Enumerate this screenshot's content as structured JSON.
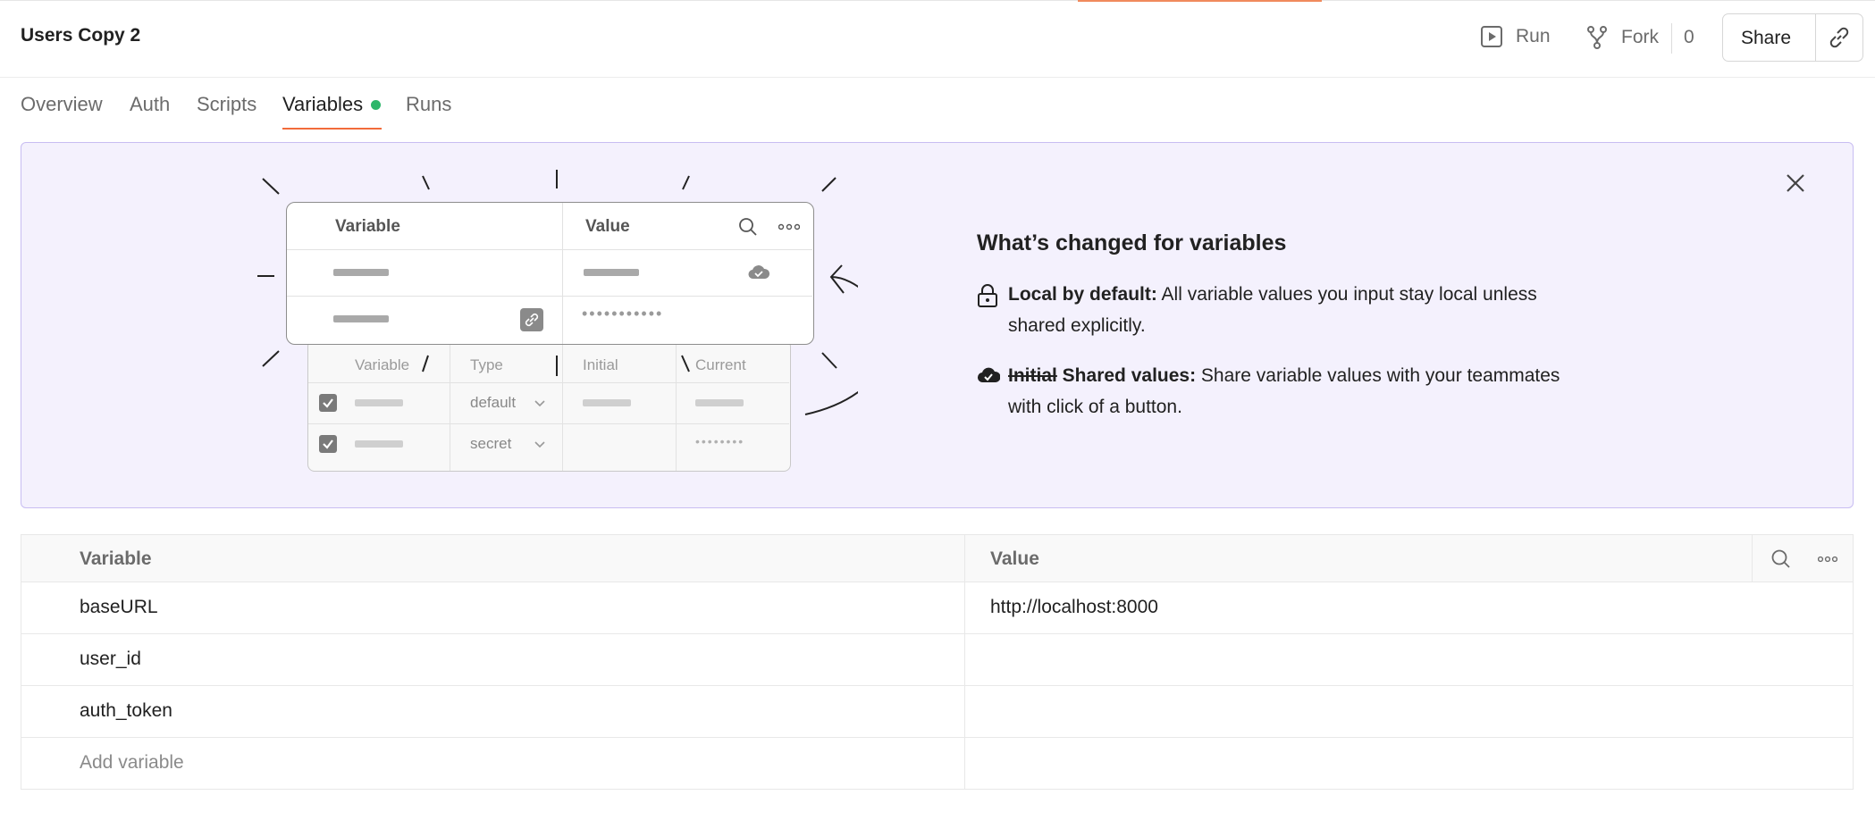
{
  "header": {
    "title": "Users Copy 2",
    "run_label": "Run",
    "fork_label": "Fork",
    "fork_count": "0",
    "share_label": "Share"
  },
  "tabs": [
    {
      "label": "Overview",
      "active": false
    },
    {
      "label": "Auth",
      "active": false
    },
    {
      "label": "Scripts",
      "active": false
    },
    {
      "label": "Variables",
      "active": true
    },
    {
      "label": "Runs",
      "active": false
    }
  ],
  "banner": {
    "heading": "What’s changed for variables",
    "feature1_bold": "Local by default:",
    "feature1_text": " All variable values you input stay local unless shared explicitly.",
    "feature2_strike": "Initial",
    "feature2_bold": " Shared values:",
    "feature2_text": " Share variable values with your teammates with click of a button.",
    "illustration": {
      "front_col1": "Variable",
      "front_col2": "Value",
      "back_col1": "Variable",
      "back_col2": "Type",
      "back_col3": "Initial",
      "back_col4": "Current",
      "back_type1": "default",
      "back_type2": "secret",
      "front_masked": "•••••••••••",
      "back_masked": "••••••••"
    }
  },
  "table": {
    "col_variable": "Variable",
    "col_value": "Value",
    "rows": [
      {
        "variable": "baseURL",
        "value": "http://localhost:8000"
      },
      {
        "variable": "user_id",
        "value": ""
      },
      {
        "variable": "auth_token",
        "value": ""
      }
    ],
    "add_placeholder": "Add variable"
  },
  "colors": {
    "accent": "#f26b3a",
    "status_dot": "#2eb66a",
    "banner_bg": "#f4f1fd",
    "banner_border": "#c8bdf2"
  }
}
